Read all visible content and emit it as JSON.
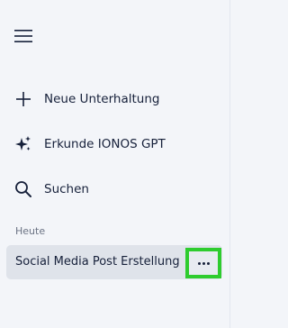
{
  "sidebar": {
    "menu_icon": "hamburger-icon",
    "items": [
      {
        "label": "Neue Unterhaltung",
        "icon": "plus-icon"
      },
      {
        "label": "Erkunde IONOS GPT",
        "icon": "sparkle-icon"
      },
      {
        "label": "Suchen",
        "icon": "search-icon"
      }
    ],
    "section_title": "Heute",
    "chats": [
      {
        "title": "Social Media Post Erstellung",
        "more_icon": "more-horizontal-icon"
      }
    ]
  },
  "colors": {
    "background": "#f3f5f9",
    "text": "#16203a",
    "muted_text": "#6b7384",
    "selected_chat": "#dfe3ea",
    "highlight": "#2ecc2e"
  }
}
